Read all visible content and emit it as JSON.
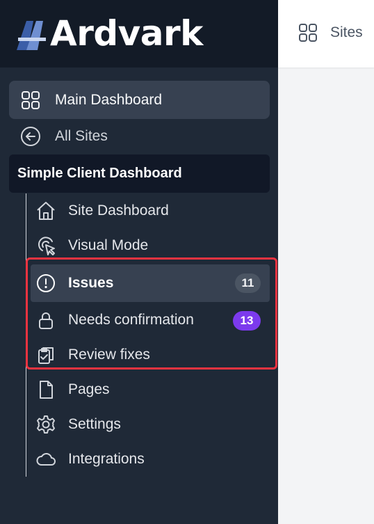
{
  "app": {
    "logo_text": "Ardvark",
    "logo_icon": "aa-logo-mark"
  },
  "topbar": {
    "sites_label": "Sites",
    "sites_icon": "grid-icon"
  },
  "sidebar": {
    "main_dashboard": {
      "label": "Main Dashboard",
      "icon": "grid-icon"
    },
    "all_sites": {
      "label": "All Sites",
      "icon": "arrow-left-circle-icon"
    },
    "client": {
      "title": "Simple Client Dashboard",
      "items": [
        {
          "label": "Site Dashboard",
          "icon": "home-icon"
        },
        {
          "label": "Visual Mode",
          "icon": "cursor-click-icon"
        },
        {
          "label": "Issues",
          "icon": "alert-circle-icon",
          "badge": "11",
          "active": true
        },
        {
          "label": "Needs confirmation",
          "icon": "lock-icon",
          "badge": "13"
        },
        {
          "label": "Review fixes",
          "icon": "clipboard-check-icon"
        },
        {
          "label": "Pages",
          "icon": "document-icon"
        },
        {
          "label": "Settings",
          "icon": "gear-icon"
        },
        {
          "label": "Integrations",
          "icon": "cloud-icon"
        }
      ]
    }
  },
  "colors": {
    "sidebar_bg": "#1f2937",
    "logo_bar_bg": "#131b27",
    "active_bg": "#374151",
    "badge_purple": "#7c3aed",
    "highlight_red": "#ef3340"
  }
}
